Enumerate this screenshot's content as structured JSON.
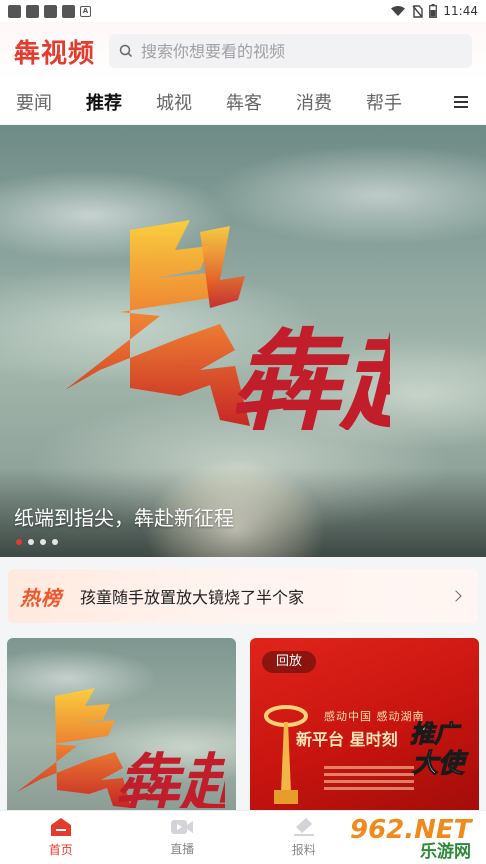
{
  "status_bar": {
    "time": "11:44"
  },
  "header": {
    "logo": "犇视频",
    "search_placeholder": "搜索你想要看的视频"
  },
  "tabs": [
    {
      "label": "要闻",
      "active": false
    },
    {
      "label": "推荐",
      "active": true
    },
    {
      "label": "城视",
      "active": false
    },
    {
      "label": "犇客",
      "active": false
    },
    {
      "label": "消费",
      "active": false
    },
    {
      "label": "帮手",
      "active": false
    }
  ],
  "banner": {
    "art_text": "犇赴",
    "caption": "纸端到指尖，犇赴新征程",
    "slide_count": 4,
    "active_slide": 1
  },
  "hot_list": {
    "label": "热榜",
    "headline": "孩童随手放置放大镜烧了半个家"
  },
  "cards": [
    {
      "art_text": "犇赴"
    },
    {
      "badge": "回放",
      "poster_line1": "感动中国  感动湖南",
      "poster_line2": "新平台 星时刻",
      "poster_big": "推广大使"
    }
  ],
  "bottom_nav": [
    {
      "label": "首页",
      "icon": "home-icon",
      "active": true
    },
    {
      "label": "直播",
      "icon": "live-video-icon",
      "active": false
    },
    {
      "label": "报料",
      "icon": "report-icon",
      "active": false
    }
  ],
  "watermark": {
    "brand": "962.NET",
    "subtitle": "乐游网"
  },
  "colors": {
    "accent": "#e33b2e",
    "hot": "#f0572a"
  }
}
